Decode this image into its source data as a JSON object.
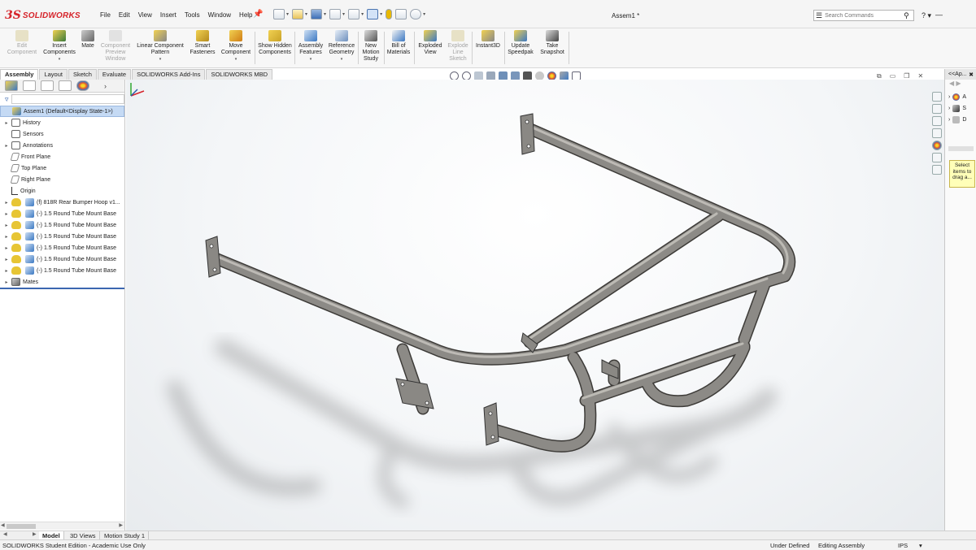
{
  "app": {
    "brand_ds": "3S",
    "brand_name": "SOLIDWORKS",
    "document_title": "Assem1 *"
  },
  "menu": [
    "File",
    "Edit",
    "View",
    "Insert",
    "Tools",
    "Window",
    "Help"
  ],
  "search": {
    "placeholder": "Search Commands"
  },
  "commands": [
    {
      "label": "Edit Component",
      "enabled": false
    },
    {
      "label": "Insert Components",
      "enabled": true
    },
    {
      "label": "Mate",
      "enabled": true
    },
    {
      "label": "Component Preview Window",
      "enabled": false
    },
    {
      "label": "Linear Component Pattern",
      "enabled": true
    },
    {
      "label": "Smart Fasteners",
      "enabled": true
    },
    {
      "label": "Move Component",
      "enabled": true
    },
    {
      "label": "Show Hidden Components",
      "enabled": true
    },
    {
      "label": "Assembly Features",
      "enabled": true
    },
    {
      "label": "Reference Geometry",
      "enabled": true
    },
    {
      "label": "New Motion Study",
      "enabled": true
    },
    {
      "label": "Bill of Materials",
      "enabled": true
    },
    {
      "label": "Exploded View",
      "enabled": true
    },
    {
      "label": "Explode Line Sketch",
      "enabled": false
    },
    {
      "label": "Instant3D",
      "enabled": true
    },
    {
      "label": "Update Speedpak",
      "enabled": true
    },
    {
      "label": "Take Snapshot",
      "enabled": true
    }
  ],
  "tabs": [
    "Assembly",
    "Layout",
    "Sketch",
    "Evaluate",
    "SOLIDWORKS Add-Ins",
    "SOLIDWORKS MBD"
  ],
  "active_tab": "Assembly",
  "tree": {
    "root": "Assem1  (Default<Display State-1>)",
    "items": [
      {
        "label": "History"
      },
      {
        "label": "Sensors"
      },
      {
        "label": "Annotations"
      },
      {
        "label": "Front Plane"
      },
      {
        "label": "Top Plane"
      },
      {
        "label": "Right Plane"
      },
      {
        "label": "Origin"
      },
      {
        "label": "(f) 818R Rear Bumper Hoop v1..."
      },
      {
        "label": "(-) 1.5 Round Tube Mount Base"
      },
      {
        "label": "(-) 1.5 Round Tube Mount Base"
      },
      {
        "label": "(-) 1.5 Round Tube Mount Base"
      },
      {
        "label": "(-) 1.5 Round Tube Mount Base"
      },
      {
        "label": "(-) 1.5 Round Tube Mount Base"
      },
      {
        "label": "(-) 1.5 Round Tube Mount Base"
      },
      {
        "label": "Mates"
      }
    ]
  },
  "task_pane": {
    "header": "<<Ap...",
    "rows": [
      "A",
      "S",
      "D"
    ],
    "tooltip": "Select items to drag a..."
  },
  "bottom_tabs": [
    "Model",
    "3D Views",
    "Motion Study 1"
  ],
  "active_bottom_tab": "Model",
  "status": {
    "left": "SOLIDWORKS Student Edition - Academic Use Only",
    "defined": "Under Defined",
    "mode": "Editing Assembly",
    "units": "IPS"
  },
  "colors": {
    "brand_red": "#d6232a",
    "selection_blue": "#c5daf4",
    "tube_steel": "#8c8a86"
  }
}
